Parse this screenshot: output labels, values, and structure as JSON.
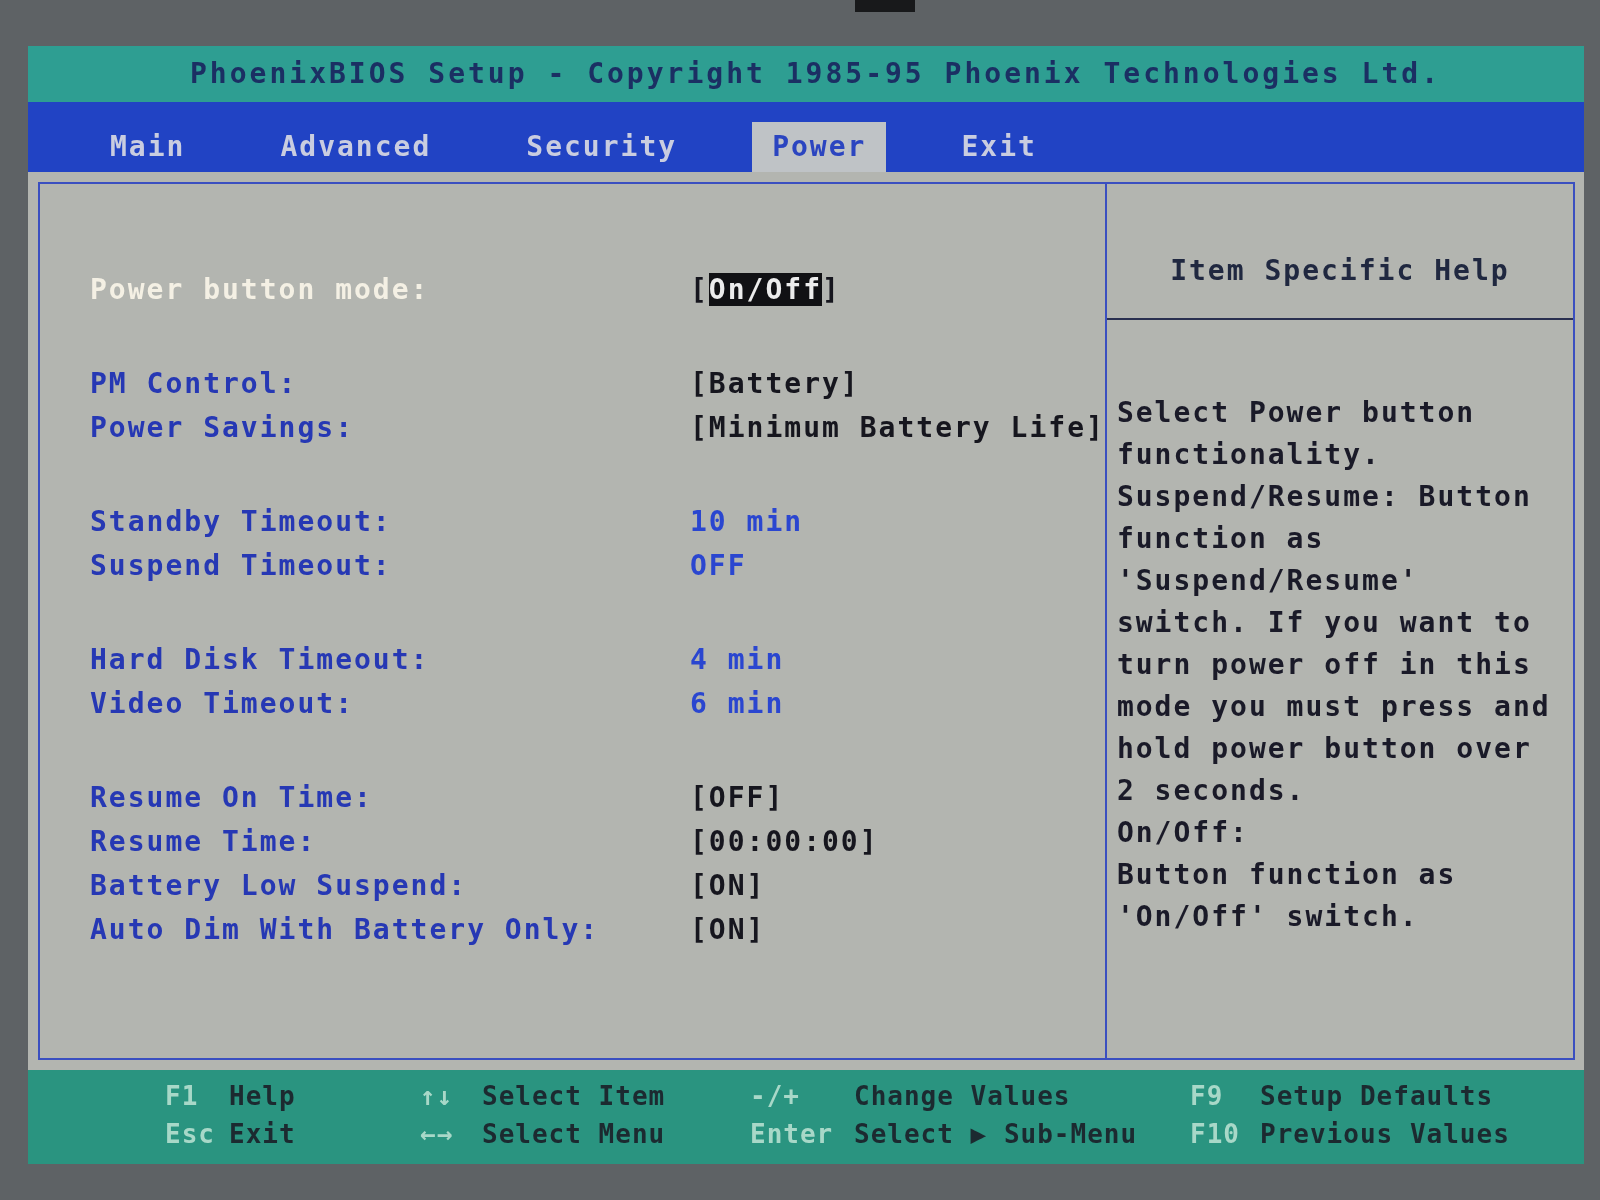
{
  "title": "PhoenixBIOS Setup - Copyright 1985-95 Phoenix Technologies Ltd.",
  "tabs": [
    {
      "label": "Main",
      "selected": false
    },
    {
      "label": "Advanced",
      "selected": false
    },
    {
      "label": "Security",
      "selected": false
    },
    {
      "label": "Power",
      "selected": true
    },
    {
      "label": "Exit",
      "selected": false
    }
  ],
  "setting_groups": [
    {
      "items": [
        {
          "label": "Power button mode:",
          "value": "[On/Off]",
          "kind": "option",
          "selected": true
        }
      ]
    },
    {
      "items": [
        {
          "label": "PM Control:",
          "value": "[Battery]",
          "kind": "option",
          "selected": false
        },
        {
          "label": "Power Savings:",
          "value": "[Minimum Battery Life]",
          "kind": "option",
          "selected": false
        }
      ]
    },
    {
      "items": [
        {
          "label": "Standby Timeout:",
          "value": "10 min",
          "kind": "info",
          "selected": false
        },
        {
          "label": "Suspend Timeout:",
          "value": "OFF",
          "kind": "info",
          "selected": false
        }
      ]
    },
    {
      "items": [
        {
          "label": "Hard Disk Timeout:",
          "value": "4 min",
          "kind": "info",
          "selected": false
        },
        {
          "label": "Video Timeout:",
          "value": "6 min",
          "kind": "info",
          "selected": false
        }
      ]
    },
    {
      "items": [
        {
          "label": "Resume On Time:",
          "value": "[OFF]",
          "kind": "option",
          "selected": false
        },
        {
          "label": "Resume Time:",
          "value": "[00:00:00]",
          "kind": "option",
          "selected": false
        },
        {
          "label": "Battery Low Suspend:",
          "value": "[ON]",
          "kind": "option",
          "selected": false
        },
        {
          "label": "Auto Dim With Battery Only:",
          "value": "[ON]",
          "kind": "option",
          "selected": false
        }
      ]
    }
  ],
  "help": {
    "title": "Item Specific Help",
    "paragraphs": [
      "Select Power button functionality.",
      "Suspend/Resume: Button function as 'Suspend/Resume' switch. If you want to turn power off in this mode you must press and hold power button over 2 seconds.",
      "On/Off:",
      "Button function as 'On/Off' switch."
    ]
  },
  "status_bar": [
    {
      "key": "F1",
      "action": "Help"
    },
    {
      "key": "↑↓",
      "action": "Select Item"
    },
    {
      "key": "-/+",
      "action": "Change Values"
    },
    {
      "key": "F9",
      "action": "Setup Defaults"
    },
    {
      "key": "Esc",
      "action": "Exit"
    },
    {
      "key": "←→",
      "action": "Select Menu"
    },
    {
      "key": "Enter",
      "action": "Select ▶ Sub-Menu"
    },
    {
      "key": "F10",
      "action": "Previous Values"
    }
  ]
}
